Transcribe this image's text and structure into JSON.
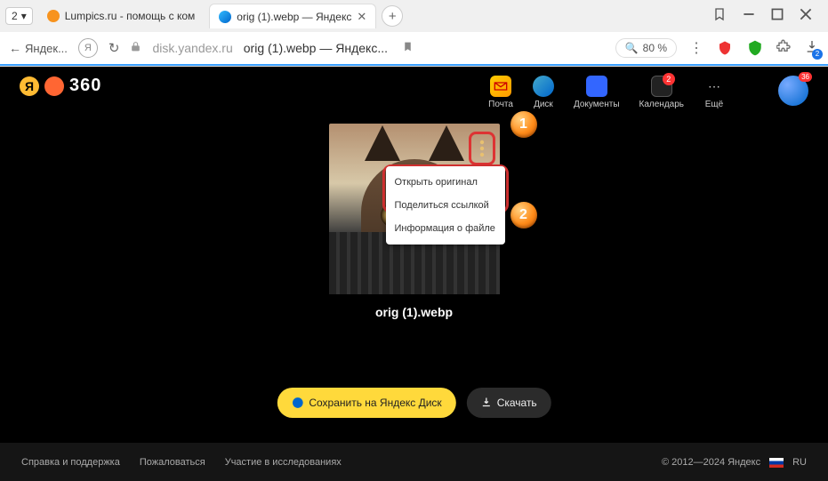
{
  "browser": {
    "tab_group_count": "2",
    "tab1": {
      "title": "Lumpics.ru - помощь с ком"
    },
    "tab2": {
      "title": "orig (1).webp — Яндекс"
    },
    "zoom": "80 %",
    "download_badge": "2"
  },
  "addressbar": {
    "back_label": "Яндек...",
    "domain": "disk.yandex.ru",
    "page_title": "orig (1).webp — Яндекс..."
  },
  "header": {
    "brand_num": "360",
    "services": {
      "mail": "Почта",
      "disk": "Диск",
      "docs": "Документы",
      "calendar": "Календарь",
      "calendar_badge": "2",
      "more": "Ещё"
    },
    "avatar_notif": "36"
  },
  "preview": {
    "filename": "orig (1).webp",
    "context_menu": {
      "open_original": "Открыть оригинал",
      "share_link": "Поделиться ссылкой",
      "file_info": "Информация о файле"
    },
    "markers": {
      "one": "1",
      "two": "2"
    }
  },
  "actions": {
    "save": "Сохранить на Яндекс Диск",
    "download": "Скачать"
  },
  "footer": {
    "help": "Справка и поддержка",
    "report": "Пожаловаться",
    "research": "Участие в исследованиях",
    "copyright": "© 2012—2024 Яндекс",
    "lang": "RU"
  }
}
